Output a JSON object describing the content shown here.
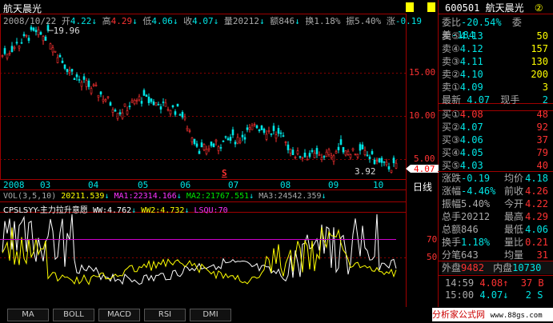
{
  "header": {
    "stock_name": "航天晨光",
    "info_date": "2008/10/22",
    "open_label": "开",
    "open_value": "4.22",
    "open_arrow": "↓",
    "high_label": "高",
    "high_value": "4.29",
    "high_arrow": "↓",
    "low_label": "低",
    "low_value": "4.06",
    "low_arrow": "↓",
    "close_label": "收",
    "close_value": "4.07",
    "close_arrow": "↓",
    "vol_label": "量",
    "vol_value": "20212",
    "vol_arrow": "↓",
    "amount_label": "额",
    "amount_value": "846",
    "amount_arrow": "↓",
    "turnover_label": "换",
    "turnover_value": "1.18%",
    "amplitude_label": "振",
    "amplitude_value": "5.40%",
    "change_label": "涨",
    "change_value": "-0.19",
    "max_label": "19.96",
    "min_label": "3.92",
    "current_price_tag": "4.07",
    "s_marker": "S"
  },
  "axis": {
    "price_ticks": [
      "15.00",
      "10.00",
      "5.00"
    ],
    "indicator_ticks": [
      "70",
      "50"
    ],
    "time_labels": [
      "2008",
      "03",
      "04",
      "05",
      "06",
      "07",
      "08",
      "09",
      "10"
    ],
    "period_label": "日线"
  },
  "vol_line": {
    "name": "VOL(3,5,10)",
    "vol": "20211.539",
    "ma1_label": "MA1:",
    "ma1": "22314.166",
    "ma2_label": "MA2:",
    "ma2": "21767.551",
    "ma3_label": "MA3:",
    "ma3": "24542.359"
  },
  "indicator_line": {
    "name": "CPSLSYY-主力拉升意愿",
    "ww_label": "WW:",
    "ww": "4.762",
    "ww2_label": "WW2:",
    "ww2": "4.732",
    "lsqu_label": "LSQU:",
    "lsqu": "70"
  },
  "tabs": [
    "MA",
    "BOLL",
    "MACD",
    "RSI",
    "DMI"
  ],
  "quote": {
    "code": "600501",
    "name": "航天晨光",
    "wei_bi_label": "委比",
    "wei_bi": "-20.54%",
    "wei_cha_label": "委差",
    "wei_cha": "-184",
    "sell": [
      {
        "label": "卖⑤",
        "price": "4.13",
        "vol": "50"
      },
      {
        "label": "卖④",
        "price": "4.12",
        "vol": "157"
      },
      {
        "label": "卖③",
        "price": "4.11",
        "vol": "130"
      },
      {
        "label": "卖②",
        "price": "4.10",
        "vol": "200"
      },
      {
        "label": "卖①",
        "price": "4.09",
        "vol": "3"
      }
    ],
    "latest_label": "最新",
    "latest": "4.07",
    "xianshou_label": "现手",
    "xianshou": "2",
    "buy": [
      {
        "label": "买①",
        "price": "4.08",
        "vol": "48"
      },
      {
        "label": "买②",
        "price": "4.07",
        "vol": "92"
      },
      {
        "label": "买③",
        "price": "4.06",
        "vol": "37"
      },
      {
        "label": "买④",
        "price": "4.05",
        "vol": "79"
      },
      {
        "label": "买⑤",
        "price": "4.03",
        "vol": "40"
      }
    ],
    "stats": [
      {
        "l1": "涨跌",
        "v1": "-0.19",
        "l2": "均价",
        "v2": "4.18"
      },
      {
        "l1": "涨幅",
        "v1": "-4.46%",
        "l2": "前收",
        "v2": "4.26"
      },
      {
        "l1": "振幅",
        "v1": "5.40%",
        "l2": "今开",
        "v2": "4.22"
      },
      {
        "l1": "总手",
        "v1": "20212",
        "l2": "最高",
        "v2": "4.29"
      },
      {
        "l1": "总额",
        "v1": "846",
        "l2": "最低",
        "v2": "4.06"
      },
      {
        "l1": "换手",
        "v1": "1.18%",
        "l2": "量比",
        "v2": "0.21"
      },
      {
        "l1": "分笔",
        "v1": "643",
        "l2": "均量",
        "v2": "31"
      }
    ],
    "outer_label": "外盘",
    "outer": "9482",
    "inner_label": "内盘",
    "inner": "10730",
    "ticks": [
      {
        "time": "14:59",
        "price": "4.08",
        "arrow": "↑",
        "vol": "37",
        "side": "B"
      },
      {
        "time": "15:00",
        "price": "4.07",
        "arrow": "↓",
        "vol": "2",
        "side": "S"
      }
    ]
  },
  "watermark": {
    "text": "分析家公式网",
    "url": "www.88gs.com"
  },
  "colors": {
    "up": "#ff3232",
    "down": "#00e5e5",
    "yellow": "#ffff00",
    "magenta": "#ff33ff",
    "grid": "#8b0000"
  }
}
